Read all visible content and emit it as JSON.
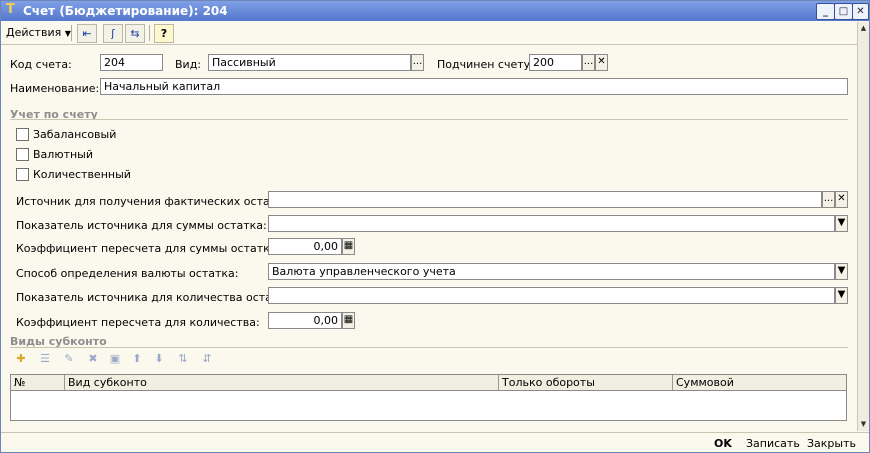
{
  "window": {
    "title": "Счет (Бюджетирование): 204",
    "controls": [
      "minimize-icon",
      "maximize-icon",
      "close-icon"
    ]
  },
  "toolbar": {
    "actions_label": "Действия",
    "icons": [
      "exit-icon",
      "formula-icon",
      "refresh-icon",
      "help-icon"
    ],
    "help_glyph": "?"
  },
  "form": {
    "code_label": "Код счета:",
    "code_value": "204",
    "kind_label": "Вид:",
    "kind_value": "Пассивный",
    "parent_label": "Подчинен счету:",
    "parent_value": "200",
    "name_label": "Наименование:",
    "name_value": "Начальный капитал"
  },
  "accounting": {
    "section_title": "Учет по счету",
    "checkboxes": [
      {
        "label": "Забалансовый",
        "checked": false
      },
      {
        "label": "Валютный",
        "checked": false
      },
      {
        "label": "Количественный",
        "checked": false
      }
    ],
    "fields": [
      {
        "label": "Источник для получения фактических остатков:",
        "value": "",
        "type": "choice-clear"
      },
      {
        "label": "Показатель источника для суммы остатка:",
        "value": "",
        "type": "dropdown"
      },
      {
        "label": "Коэффициент пересчета для суммы остатка:",
        "value": "0,00",
        "type": "number"
      },
      {
        "label": "Способ определения валюты остатка:",
        "value": "Валюта управленческого учета",
        "type": "dropdown"
      },
      {
        "label": "Показатель источника для количества остатка:",
        "value": "",
        "type": "dropdown"
      },
      {
        "label": "Коэффициент пересчета для количества:",
        "value": "0,00",
        "type": "number"
      }
    ]
  },
  "subconto": {
    "section_title": "Виды субконто",
    "toolbar_icons": [
      "add-icon",
      "add-copy-icon",
      "edit-icon",
      "delete-icon",
      "save-icon",
      "move-up-icon",
      "move-down-icon",
      "sort-asc-icon",
      "sort-desc-icon"
    ],
    "columns": [
      "№",
      "Вид субконто",
      "Только обороты",
      "Суммовой"
    ],
    "rows": []
  },
  "footer": {
    "ok_label": "OK",
    "save_label": "Записать",
    "close_label": "Закрыть"
  },
  "colors": {
    "titlebar": "#5577cc",
    "form_background": "#fbf9ee",
    "section_text": "#8e8e8e"
  }
}
